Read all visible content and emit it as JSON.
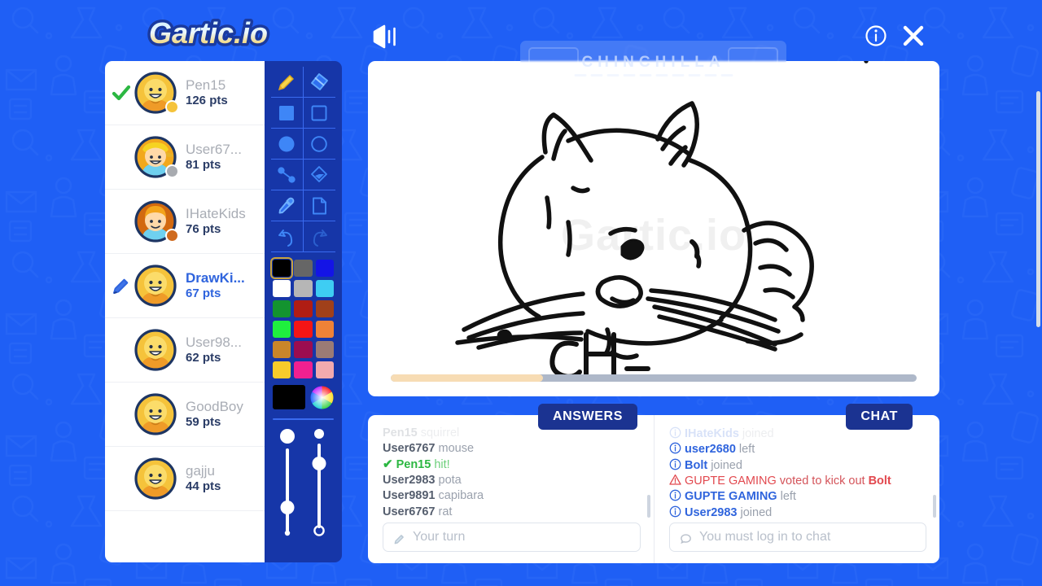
{
  "app": {
    "title": "Gartic.io",
    "logo_text_a": "Gartic",
    "logo_text_b": ".io",
    "background_color": "#1f5ff5"
  },
  "header": {
    "sound_icon": "speaker-on-icon",
    "info_icon": "info-circle-icon",
    "close_icon": "close-x-icon"
  },
  "word_overlay": {
    "word": "CHINCHILLA",
    "letter_count": 10,
    "dash_count": 10
  },
  "players": {
    "scroll_visible": true,
    "items": [
      {
        "name": "Pen15",
        "points": "126 pts",
        "marker": "check-icon",
        "dot_color": "#f5c33b",
        "avatar": "bald-yellow-shirt",
        "is_drawer": false,
        "guessed": true
      },
      {
        "name": "User67...",
        "points": "81 pts",
        "marker": "none",
        "dot_color": "#a8abb0",
        "avatar": "boy-yellow-cap",
        "is_drawer": false,
        "guessed": false
      },
      {
        "name": "IHateKids",
        "points": "76 pts",
        "marker": "none",
        "dot_color": "#cf6a1e",
        "avatar": "orange-hair-boy",
        "is_drawer": false,
        "guessed": false
      },
      {
        "name": "DrawKi...",
        "points": "67 pts",
        "marker": "pencil-icon",
        "dot_color": "none",
        "avatar": "bald-yellow-shirt",
        "is_drawer": true,
        "guessed": false
      },
      {
        "name": "User98...",
        "points": "62 pts",
        "marker": "none",
        "dot_color": "none",
        "avatar": "bald-yellow-shirt",
        "is_drawer": false,
        "guessed": false
      },
      {
        "name": "GoodBoy",
        "points": "59 pts",
        "marker": "none",
        "dot_color": "none",
        "avatar": "bald-yellow-shirt",
        "is_drawer": false,
        "guessed": false
      },
      {
        "name": "gajju",
        "points": "44 pts",
        "marker": "none",
        "dot_color": "none",
        "avatar": "bald-yellow-shirt",
        "is_drawer": false,
        "guessed": false
      }
    ]
  },
  "tools": {
    "items": [
      {
        "name": "pencil-tool",
        "icon": "pencil-icon",
        "selected": true
      },
      {
        "name": "eraser-tool",
        "icon": "eraser-icon",
        "selected": false
      },
      {
        "name": "filled-rectangle-tool",
        "icon": "filled-square-icon",
        "selected": false
      },
      {
        "name": "outline-rectangle-tool",
        "icon": "outline-square-icon",
        "selected": false
      },
      {
        "name": "filled-ellipse-tool",
        "icon": "filled-circle-icon",
        "selected": false
      },
      {
        "name": "outline-ellipse-tool",
        "icon": "outline-circle-icon",
        "selected": false
      },
      {
        "name": "line-tool",
        "icon": "line-nodes-icon",
        "selected": false
      },
      {
        "name": "fill-bucket-tool",
        "icon": "paint-bucket-icon",
        "selected": false
      },
      {
        "name": "color-picker-tool",
        "icon": "eyedropper-icon",
        "selected": false
      },
      {
        "name": "new-page-tool",
        "icon": "page-icon",
        "selected": false
      },
      {
        "name": "undo-tool",
        "icon": "undo-arrow-icon",
        "selected": false
      },
      {
        "name": "redo-tool",
        "icon": "redo-arrow-icon",
        "selected": false
      }
    ]
  },
  "palette": {
    "selected_index": 0,
    "colors": [
      "#000000",
      "#666666",
      "#1414e6",
      "#ffffff",
      "#b6b6b6",
      "#3ecdf3",
      "#13932f",
      "#b01d14",
      "#a0401a",
      "#1ff03e",
      "#f41515",
      "#f08237",
      "#c9852a",
      "#9c0d50",
      "#9b7b75",
      "#f7cb2b",
      "#f02090",
      "#f3aaae"
    ],
    "current_color": "#000000",
    "wheel_icon": "color-wheel-icon"
  },
  "sliders": [
    {
      "name": "brush-size-slider",
      "top_glyph": "large-dot",
      "bottom_glyph": "small-dot",
      "value_pos": 0.74
    },
    {
      "name": "brush-opacity-slider",
      "top_glyph": "small-dot",
      "bottom_glyph": "ring",
      "value_pos": 0.18
    }
  ],
  "canvas": {
    "watermark": "Gartic.io",
    "drawing_label": "chinchilla-sketch",
    "sketch_text": "CH_",
    "progress_percent": 29,
    "progress_color": "#f7dcb4",
    "progress_track_color": "#aeb8c9"
  },
  "answers": {
    "tab_label": "ANSWERS",
    "messages": [
      {
        "type": "guess",
        "who": "Pen15",
        "what": "squirrel",
        "faded": true
      },
      {
        "type": "guess",
        "who": "User6767",
        "what": "mouse",
        "faded": false
      },
      {
        "type": "hit",
        "who": "Pen15",
        "what": "hit!",
        "faded": false
      },
      {
        "type": "guess",
        "who": "User2983",
        "what": "pota",
        "faded": false
      },
      {
        "type": "guess",
        "who": "User9891",
        "what": "capibara",
        "faded": false
      },
      {
        "type": "guess",
        "who": "User6767",
        "what": "rat",
        "faded": false
      }
    ],
    "input_placeholder": "Your turn",
    "input_value": "",
    "input_icon": "pencil-icon"
  },
  "chat": {
    "tab_label": "CHAT",
    "messages": [
      {
        "type": "info",
        "who": "IHateKids",
        "what": "joined",
        "faded": true
      },
      {
        "type": "info",
        "who": "user2680",
        "what": "left",
        "faded": false
      },
      {
        "type": "info",
        "who": "Bolt",
        "what": "joined",
        "faded": false
      },
      {
        "type": "warn",
        "who": "GUPTE GAMING",
        "what": "voted to kick out",
        "target": "Bolt",
        "faded": false
      },
      {
        "type": "info",
        "who": "GUPTE GAMING",
        "what": "left",
        "faded": false
      },
      {
        "type": "info",
        "who": "User2983",
        "what": "joined",
        "faded": false
      }
    ],
    "input_placeholder": "You must log in to chat",
    "input_value": "",
    "input_icon": "chat-bubble-icon"
  }
}
